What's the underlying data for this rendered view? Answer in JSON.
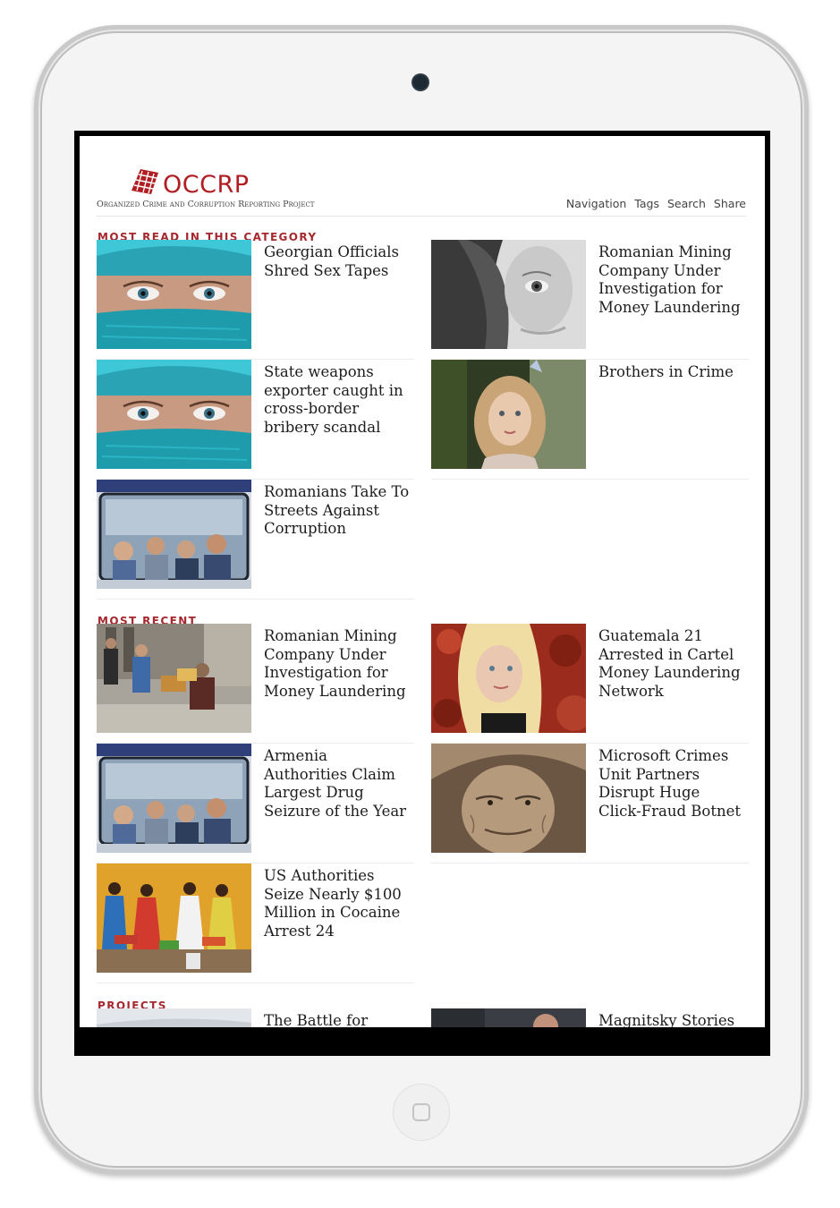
{
  "brand": {
    "name": "OCCRP",
    "subtitle": "Organized Crime and Corruption Reporting Project"
  },
  "nav": [
    "Navigation",
    "Tags",
    "Search",
    "Share"
  ],
  "sections": {
    "most_read": {
      "label": "MOST READ IN THIS CATEGORY",
      "items": [
        {
          "title": "Georgian Officials Shred Sex Tapes",
          "image": "woman-cyan-scarf"
        },
        {
          "title": "Romanian Mining Company Under Investigation for Money Laundering",
          "image": "bw-face-closeup"
        },
        {
          "title": "State weapons exporter caught in cross-border bribery scandal",
          "image": "woman-cyan-scarf"
        },
        {
          "title": "Brothers in Crime",
          "image": "curly-girl-portrait"
        },
        {
          "title": "Romanians Take To Streets Against Corruption",
          "image": "people-in-tram"
        }
      ]
    },
    "most_recent": {
      "label": "MOST RECENT",
      "items": [
        {
          "title": "Romanian Mining Company Under Investigation for Money Laundering",
          "image": "street-scene"
        },
        {
          "title": "Guatemala 21 Arrested in Cartel Money Laundering Network",
          "image": "blonde-woman-red-leaves"
        },
        {
          "title": "Armenia Authorities Claim Largest Drug Seizure of the Year",
          "image": "people-in-tram"
        },
        {
          "title": "Microsoft Crimes Unit Partners Disrupt Huge Click-Fraud Botnet",
          "image": "elderly-woman-sepia"
        },
        {
          "title": "US Authorities Seize Nearly $100 Million in Cocaine Arrest 24",
          "image": "fruit-vendors"
        }
      ]
    },
    "projects": {
      "label": "PROJECTS",
      "items": [
        {
          "title": "The Battle for",
          "image": "sky-landscape"
        },
        {
          "title": "Magnitsky Stories",
          "image": "man-portrait"
        }
      ]
    }
  },
  "colors": {
    "accent": "#a5282e",
    "brand_red": "#b01e23",
    "device_frame": "#c9c9c9"
  }
}
